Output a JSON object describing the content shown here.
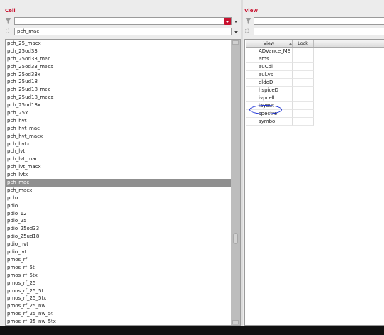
{
  "cell_panel": {
    "title": "Cell",
    "search_value": "pch_mac",
    "selected_item": "pch_mac",
    "items": [
      "pch_25_macx",
      "pch_25od33",
      "pch_25od33_mac",
      "pch_25od33_macx",
      "pch_25od33x",
      "pch_25ud18",
      "pch_25ud18_mac",
      "pch_25ud18_macx",
      "pch_25ud18x",
      "pch_25x",
      "pch_hvt",
      "pch_hvt_mac",
      "pch_hvt_macx",
      "pch_hvtx",
      "pch_lvt",
      "pch_lvt_mac",
      "pch_lvt_macx",
      "pch_lvtx",
      "pch_mac",
      "pch_macx",
      "pchx",
      "pdio",
      "pdio_12",
      "pdio_25",
      "pdio_25od33",
      "pdio_25ud18",
      "pdio_hvt",
      "pdio_lvt",
      "pmos_rf",
      "pmos_rf_5t",
      "pmos_rf_5tx",
      "pmos_rf_25",
      "pmos_rf_25_5t",
      "pmos_rf_25_5tx",
      "pmos_rf_25_nw",
      "pmos_rf_25_nw_5t",
      "pmos_rf_25_nw_5tx"
    ]
  },
  "view_panel": {
    "title": "View",
    "columns": [
      "View",
      "Lock"
    ],
    "items": [
      "ADVance_MS",
      "ams",
      "auCdl",
      "auLvs",
      "eldoD",
      "hspiceD",
      "ivpcell",
      "layout",
      "spectre",
      "symbol"
    ]
  },
  "icons": {
    "filter": "filter-icon",
    "search": "search-tree-icon",
    "dropdown": "chevron-down-icon"
  },
  "colors": {
    "accent": "#c8102e",
    "selection": "#8f8f8f",
    "annotation": "#1a2fd6"
  }
}
